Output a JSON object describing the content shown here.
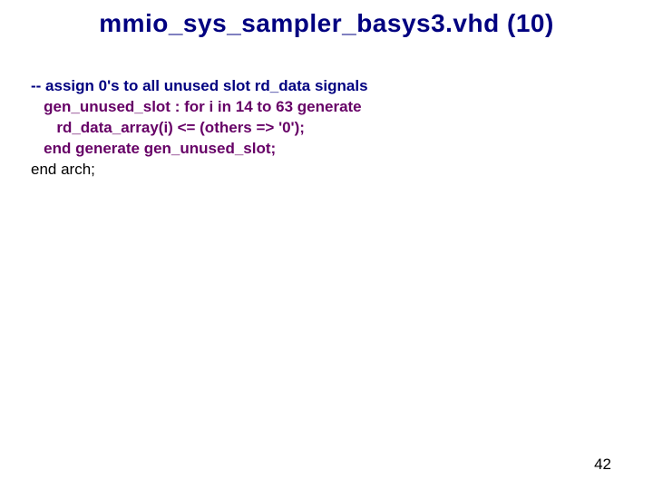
{
  "title": "mmio_sys_sampler_basys3.vhd (10)",
  "code": {
    "comment": "-- assign 0's to all unused slot rd_data signals",
    "line1": "   gen_unused_slot : for i in 14 to 63 generate",
    "line2": "      rd_data_array(i) <= (others => '0');",
    "line3": "   end generate gen_unused_slot;",
    "end_arch": "end arch;"
  },
  "page_number": "42"
}
